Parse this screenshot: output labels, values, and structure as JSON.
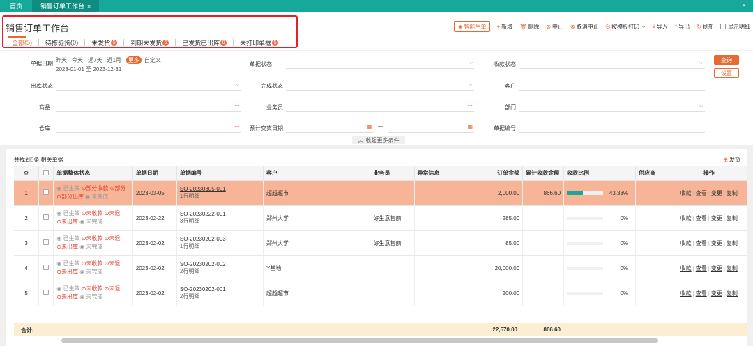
{
  "topbar": {
    "home_tab": "首页",
    "active_tab": "销售订单工作台",
    "tab_close": "×",
    "window_close": "×"
  },
  "header": {
    "title": "销售订单工作台",
    "toolbar": {
      "quick_create": "智能生单",
      "add": "新增",
      "delete": "删除",
      "stop": "中止",
      "cancel_stop": "取消中止",
      "print_template": "按模板打印",
      "import": "导入",
      "export": "导出",
      "refresh": "刷新",
      "show_details": "显示明细"
    },
    "filter_tabs": [
      {
        "label": "全部",
        "count": "5"
      },
      {
        "label": "待拣验货",
        "count": "0"
      },
      {
        "label": "未发货",
        "badge": "5"
      },
      {
        "label": "到期未发货",
        "badge": "5"
      },
      {
        "label": "已发货已出库",
        "badge": "0"
      },
      {
        "label": "未打印单据",
        "badge": "5"
      }
    ]
  },
  "form": {
    "date_label": "单据日期",
    "date_quick": [
      "昨天",
      "今天",
      "近7天",
      "近1月"
    ],
    "date_more": "更多",
    "date_custom": "自定义",
    "date_range": "2023-01-01 至 2023-12-31",
    "doc_status_label": "单据状态",
    "collect_status_label": "收款状态",
    "outbound_status_label": "出库状态",
    "complete_status_label": "完成状态",
    "customer_label": "客户",
    "goods_label": "商品",
    "salesman_label": "业务员",
    "dept_label": "部门",
    "warehouse_label": "仓库",
    "expected_date_label": "预计交货日期",
    "date_sep": "—",
    "doc_no_label": "单据编号",
    "query_btn": "查询",
    "settings_btn": "设置",
    "collapse": "收起更多条件",
    "more_suffix": "···",
    "chevron": "⌵"
  },
  "table": {
    "found_prefix": "共找到",
    "found_count": "5",
    "found_suffix": "条 相关单据",
    "ship_btn": "发货",
    "headers": {
      "settings": "⚙",
      "status": "单据整体状态",
      "date": "单据日期",
      "doc_no": "单据编号",
      "customer": "客户",
      "salesman": "业务员",
      "abnormal": "异常信息",
      "amount": "订单金额",
      "collected": "累计收款金额",
      "ratio": "收款比例",
      "supplier": "供应商",
      "ops": "操作"
    },
    "rows": [
      {
        "idx": "1",
        "s1": "已生效",
        "s2": "部分收款",
        "s3": "部分",
        "s4": "部分出库",
        "s5": "未完成",
        "date": "2023-03-05",
        "doc_no": "SO-20230305-001",
        "lines": "1行明细",
        "customer": "超超超市",
        "salesman": "",
        "amount": "2,000.00",
        "collected": "866.60",
        "ratio": 0.4333,
        "ratio_text": "43.33%"
      },
      {
        "idx": "2",
        "s1": "已生效",
        "s2": "未收款",
        "s3": "未退",
        "s4": "未出库",
        "s5": "未完成",
        "date": "2023-02-22",
        "doc_no": "SO-20230222-001",
        "lines": "3行明细",
        "customer": "郑州大学",
        "salesman": "好生意售前",
        "amount": "285.00",
        "collected": "",
        "ratio": 0,
        "ratio_text": "0%"
      },
      {
        "idx": "3",
        "s1": "已生效",
        "s2": "未收款",
        "s3": "未退",
        "s4": "未出库",
        "s5": "未完成",
        "date": "2023-02-02",
        "doc_no": "SO-20230202-003",
        "lines": "1行明细",
        "customer": "郑州大学",
        "salesman": "好生意售前",
        "amount": "85.00",
        "collected": "",
        "ratio": 0,
        "ratio_text": "0%"
      },
      {
        "idx": "4",
        "s1": "已生效",
        "s2": "未收款",
        "s3": "未退",
        "s4": "未出库",
        "s5": "未完成",
        "date": "2023-02-02",
        "doc_no": "SO-20230202-002",
        "lines": "2行明细",
        "customer": "Y基地",
        "salesman": "",
        "amount": "20,000.00",
        "collected": "",
        "ratio": 0,
        "ratio_text": "0%"
      },
      {
        "idx": "5",
        "s1": "已生效",
        "s2": "未收款",
        "s3": "未退",
        "s4": "未出库",
        "s5": "未完成",
        "date": "2023-02-02",
        "doc_no": "SO-20230202-001",
        "lines": "2行明细",
        "customer": "超超超市",
        "salesman": "",
        "amount": "200.00",
        "collected": "",
        "ratio": 0,
        "ratio_text": "0%"
      }
    ],
    "ops": [
      "收款",
      "查看",
      "变更",
      "复制"
    ],
    "totals": {
      "label": "合计:",
      "amount": "22,570.00",
      "collected": "866.60"
    }
  },
  "colors": {
    "accent": "#e86a33",
    "topbar": "#16a99a",
    "selected_row": "#f7b497",
    "frame": "#e5202c"
  }
}
